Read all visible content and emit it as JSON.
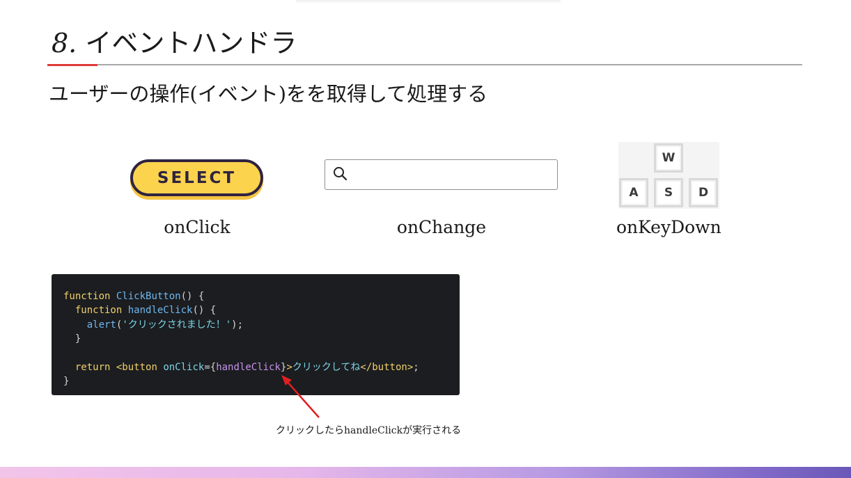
{
  "slide": {
    "title_number": "8.",
    "title_text": "イベントハンドラ",
    "subtitle": "ユーザーの操作(イベント)をを取得して処理する"
  },
  "examples": [
    {
      "widget_label": "SELECT",
      "caption": "onClick"
    },
    {
      "widget_label": "",
      "caption": "onChange"
    },
    {
      "keys": [
        "W",
        "A",
        "S",
        "D"
      ],
      "caption": "onKeyDown"
    }
  ],
  "code": {
    "line1": {
      "kw": "function",
      "name": "ClickButton",
      "rest": "() {"
    },
    "line2": {
      "kw": "function",
      "name": "handleClick",
      "rest": "() {"
    },
    "line3": {
      "call": "alert",
      "open": "(",
      "str": "'クリックされました！'",
      "close": ");"
    },
    "line4": "}",
    "line6": {
      "kw": "return",
      "open_tag": "<button",
      "attr": "onClick",
      "eq": "={",
      "handler": "handleClick",
      "close_brace": "}",
      "gt": ">",
      "text": "クリックしてね",
      "close_tag": "</button>",
      "semi": ";"
    },
    "line7": "}"
  },
  "annotation": {
    "text": "クリックしたらhandleClickが実行される",
    "arrow_color": "#e02020"
  },
  "colors": {
    "accent_red": "#e03a3a",
    "button_yellow": "#fcd34d",
    "button_border": "#2f2340",
    "code_bg": "#1b1d20"
  }
}
